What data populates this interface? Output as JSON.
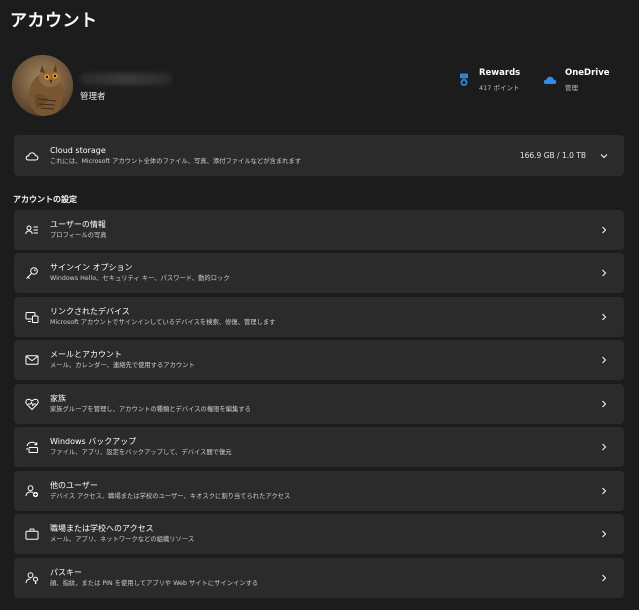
{
  "page": {
    "title": "アカウント"
  },
  "profile": {
    "role": "管理者"
  },
  "services": {
    "rewards": {
      "title": "Rewards",
      "subtitle": "417 ポイント",
      "color": "#2b88d8"
    },
    "onedrive": {
      "title": "OneDrive",
      "subtitle": "管理",
      "color": "#2f8fe6"
    }
  },
  "storage": {
    "title": "Cloud storage",
    "subtitle": "これには、Microsoft アカウント全体のファイル、写真、添付ファイルなどが含まれます",
    "usage": "166.9 GB / 1.0 TB",
    "icon": "cloud-icon"
  },
  "settings_section": {
    "heading": "アカウントの設定"
  },
  "settings": [
    {
      "title": "ユーザーの情報",
      "subtitle": "プロフィールの写真",
      "icon": "user-info-icon"
    },
    {
      "title": "サインイン オプション",
      "subtitle": "Windows Hello、セキュリティ キー、パスワード、動的ロック",
      "icon": "key-icon"
    },
    {
      "title": "リンクされたデバイス",
      "subtitle": "Microsoft アカウントでサインインしているデバイスを検索、修復、管理します",
      "icon": "devices-icon"
    },
    {
      "title": "メールとアカウント",
      "subtitle": "メール、カレンダー、連絡先で使用するアカウント",
      "icon": "mail-icon"
    },
    {
      "title": "家族",
      "subtitle": "家族グループを管理し、アカウントの種類とデバイスの権限を編集する",
      "icon": "family-heart-icon"
    },
    {
      "title": "Windows バックアップ",
      "subtitle": "ファイル、アプリ、設定をバックアップして、デバイス間で復元",
      "icon": "backup-icon"
    },
    {
      "title": "他のユーザー",
      "subtitle": "デバイス アクセス、職場または学校のユーザー、キオスクに割り当てられたアクセス",
      "icon": "other-users-icon"
    },
    {
      "title": "職場または学校へのアクセス",
      "subtitle": "メール、アプリ、ネットワークなどの組織リソース",
      "icon": "briefcase-icon"
    },
    {
      "title": "パスキー",
      "subtitle": "顔、指紋、または PIN を使用してアプリや Web サイトにサインインする",
      "icon": "passkey-icon"
    }
  ]
}
